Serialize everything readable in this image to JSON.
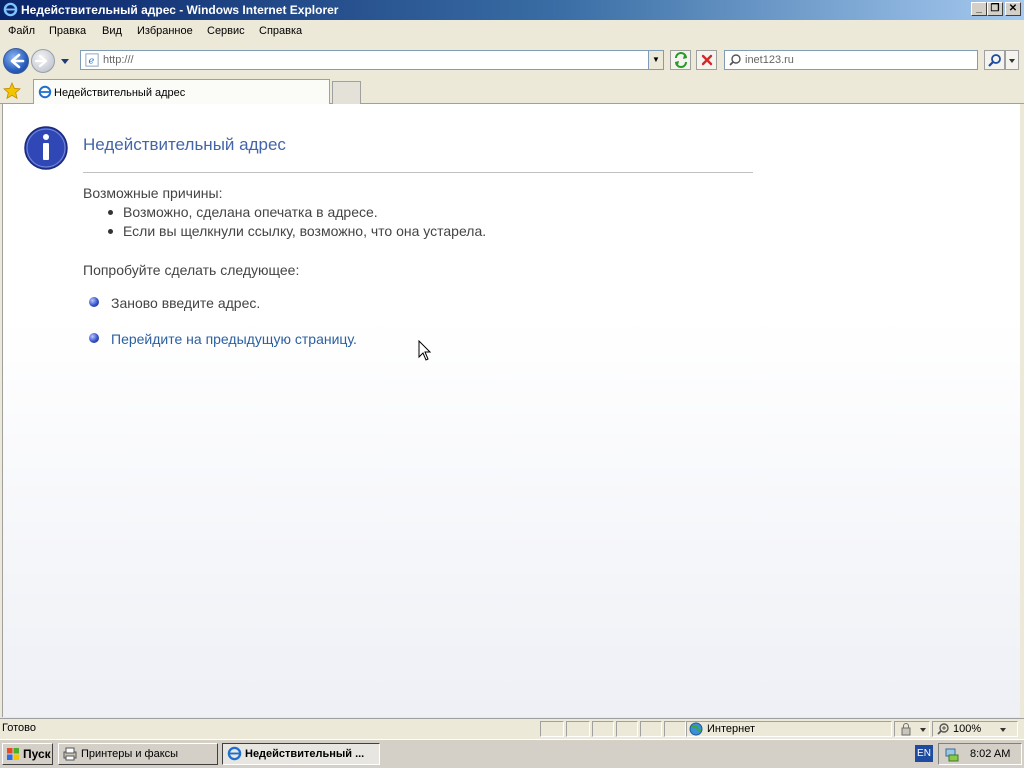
{
  "window": {
    "title": "Недействительный адрес - Windows Internet Explorer"
  },
  "menu": {
    "items": [
      "Файл",
      "Правка",
      "Вид",
      "Избранное",
      "Сервис",
      "Справка"
    ]
  },
  "navigation": {
    "address_value": "http:///",
    "search_placeholder": "inet123.ru"
  },
  "tabs": {
    "active_label": "Недействительный адрес"
  },
  "page": {
    "title": "Недействительный адрес",
    "reasons_heading": "Возможные причины:",
    "reasons": [
      "Возможно, сделана опечатка в адресе.",
      "Если вы щелкнули ссылку, возможно, что она устарела."
    ],
    "try_heading": "Попробуйте сделать следующее:",
    "actions": [
      "Заново введите адрес.",
      "Перейдите на предыдущую страницу."
    ]
  },
  "status": {
    "text": "Готово",
    "zone": "Интернет",
    "zoom": "100%"
  },
  "taskbar": {
    "start_label": "Пуск",
    "tasks": [
      "Принтеры и факсы",
      "Недействительный ..."
    ],
    "language": "EN",
    "clock": "8:02 AM"
  },
  "colors": {
    "title_gradient_start": "#0a246a",
    "page_title": "#4466a8",
    "link": "#2b5fa0",
    "info_icon": "#2f48b5"
  }
}
